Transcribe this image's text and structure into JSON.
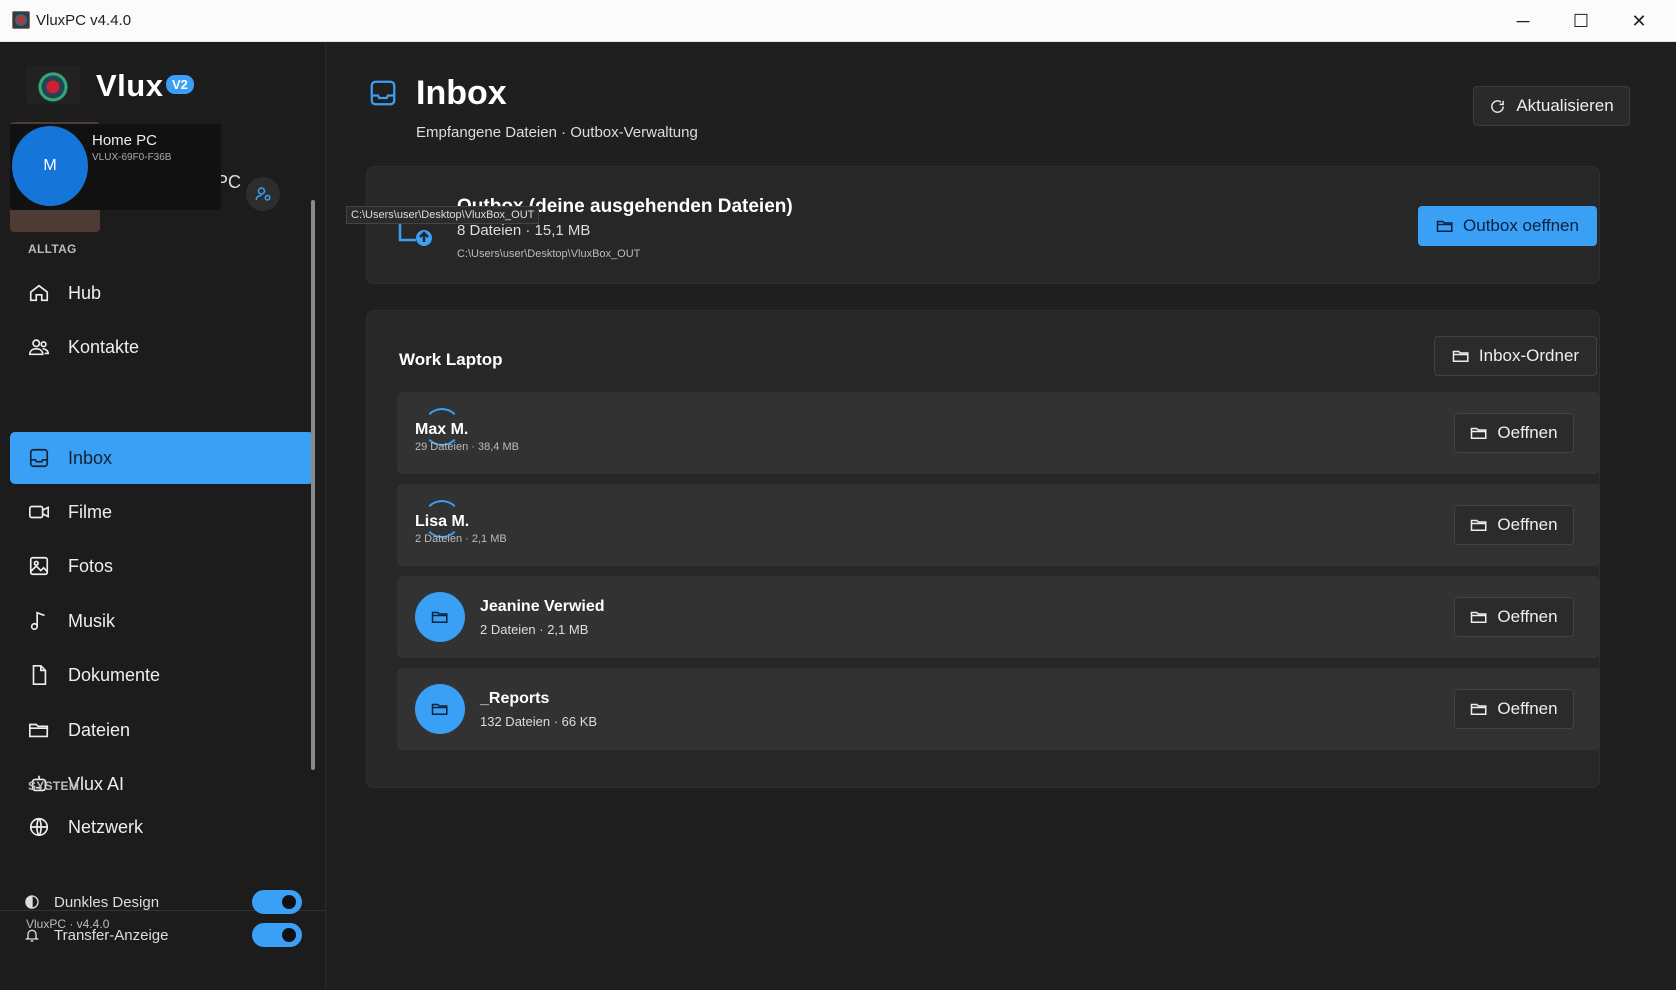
{
  "window": {
    "title": "VluxPC v4.4.0",
    "minimize": "─",
    "maximize": "☐",
    "close": "✕"
  },
  "sidebar": {
    "brand": "Vlux",
    "badge": "V2",
    "profile": {
      "pc_suffix": "PC",
      "popover_initial": "M",
      "popover_name": "Home PC",
      "popover_id": "VLUX-69F0-F36B"
    },
    "section_daily": "ALLTAG",
    "items": [
      {
        "label": "Hub",
        "icon": "home-icon"
      },
      {
        "label": "Kontakte",
        "icon": "users-icon"
      },
      {
        "label": "Inbox",
        "icon": "inbox-icon",
        "active": true
      },
      {
        "label": "Filme",
        "icon": "video-icon"
      },
      {
        "label": "Fotos",
        "icon": "image-icon"
      },
      {
        "label": "Musik",
        "icon": "music-icon"
      },
      {
        "label": "Dokumente",
        "icon": "document-icon"
      },
      {
        "label": "Dateien",
        "icon": "folder-icon"
      },
      {
        "label": "Vlux AI",
        "icon": "bot-icon"
      }
    ],
    "section_system": "SYSTEM",
    "system_items": [
      {
        "label": "Netzwerk",
        "icon": "globe-icon"
      }
    ],
    "toggles": [
      {
        "label": "Dunkles Design",
        "icon": "contrast-icon",
        "on": true
      },
      {
        "label": "Transfer-Anzeige",
        "icon": "bell-icon",
        "on": true
      }
    ],
    "version": "VluxPC · v4.4.0"
  },
  "main": {
    "title": "Inbox",
    "subtitle": "Empfangene Dateien · Outbox-Verwaltung",
    "refresh_label": "Aktualisieren",
    "outbox": {
      "title": "Outbox (deine ausgehenden Dateien)",
      "count": "8 Dateien · 15,1 MB",
      "path": "C:\\Users\\user\\Desktop\\VluxBox_OUT",
      "tooltip": "C:\\Users\\user\\Desktop\\VluxBox_OUT",
      "button": "Outbox oeffnen"
    },
    "group": {
      "title": "Work Laptop",
      "folder_button": "Inbox-Ordner",
      "rows": [
        {
          "name": "Max M.",
          "meta": "29 Dateien · 38,4 MB",
          "button": "Oeffnen"
        },
        {
          "name": "Lisa M.",
          "meta": "2 Dateien · 2,1 MB",
          "button": "Oeffnen"
        },
        {
          "name": "Jeanine Verwied",
          "meta": "2 Dateien  ·  2,1 MB",
          "button": "Oeffnen"
        },
        {
          "name": "_Reports",
          "meta": "132 Dateien  ·  66 KB",
          "button": "Oeffnen"
        }
      ]
    }
  },
  "colors": {
    "accent": "#3aa0f5",
    "background": "#1f1f1f",
    "card": "#272727"
  }
}
